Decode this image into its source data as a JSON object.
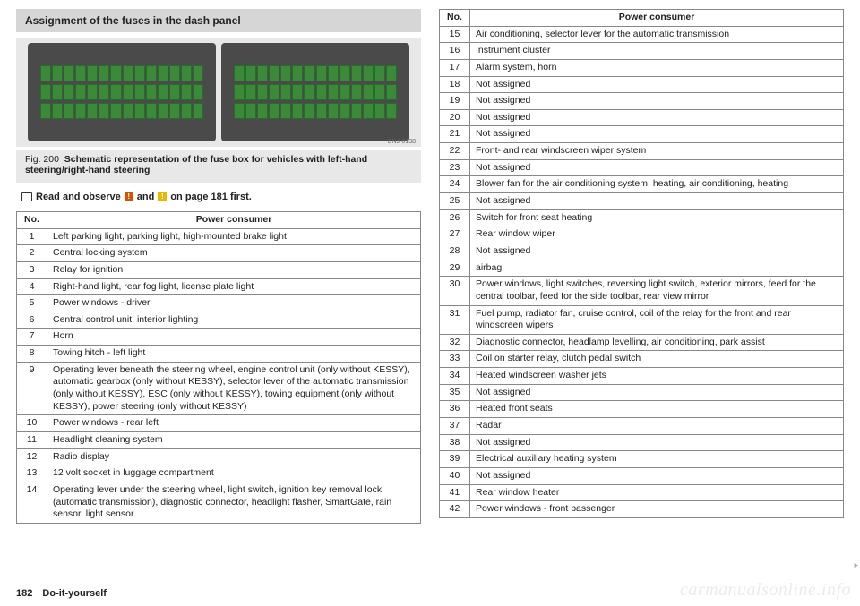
{
  "header": {
    "title": "Assignment of the fuses in the dash panel"
  },
  "figure": {
    "code": "BNJ-0138",
    "label": "Fig. 200",
    "caption": "Schematic representation of the fuse box for vehicles with left-hand steering/right-hand steering"
  },
  "read_observe": {
    "prefix": "Read and observe",
    "mid": "and",
    "suffix": "on page 181 first."
  },
  "table_headers": {
    "no": "No.",
    "consumer": "Power consumer"
  },
  "fuses_left": [
    {
      "no": "1",
      "desc": "Left parking light, parking light, high-mounted brake light"
    },
    {
      "no": "2",
      "desc": "Central locking system"
    },
    {
      "no": "3",
      "desc": "Relay for ignition"
    },
    {
      "no": "4",
      "desc": "Right-hand light, rear fog light, license plate light"
    },
    {
      "no": "5",
      "desc": "Power windows - driver"
    },
    {
      "no": "6",
      "desc": "Central control unit, interior lighting"
    },
    {
      "no": "7",
      "desc": "Horn"
    },
    {
      "no": "8",
      "desc": "Towing hitch - left light"
    },
    {
      "no": "9",
      "desc": "Operating lever beneath the steering wheel, engine control unit (only without KESSY), automatic gearbox (only without KESSY), selector lever of the automatic transmission (only without KESSY), ESC (only without KESSY), towing equipment (only without KESSY), power steering (only without KESSY)"
    },
    {
      "no": "10",
      "desc": "Power windows - rear left"
    },
    {
      "no": "11",
      "desc": "Headlight cleaning system"
    },
    {
      "no": "12",
      "desc": "Radio display"
    },
    {
      "no": "13",
      "desc": "12 volt socket in luggage compartment"
    },
    {
      "no": "14",
      "desc": "Operating lever under the steering wheel, light switch, ignition key removal lock (automatic transmission), diagnostic connector, headlight flasher, SmartGate, rain sensor, light sensor"
    }
  ],
  "fuses_right": [
    {
      "no": "15",
      "desc": "Air conditioning, selector lever for the automatic transmission"
    },
    {
      "no": "16",
      "desc": "Instrument cluster"
    },
    {
      "no": "17",
      "desc": "Alarm system, horn"
    },
    {
      "no": "18",
      "desc": "Not assigned"
    },
    {
      "no": "19",
      "desc": "Not assigned"
    },
    {
      "no": "20",
      "desc": "Not assigned"
    },
    {
      "no": "21",
      "desc": "Not assigned"
    },
    {
      "no": "22",
      "desc": "Front- and rear windscreen wiper system"
    },
    {
      "no": "23",
      "desc": "Not assigned"
    },
    {
      "no": "24",
      "desc": "Blower fan for the air conditioning system, heating, air conditioning, heating"
    },
    {
      "no": "25",
      "desc": "Not assigned"
    },
    {
      "no": "26",
      "desc": "Switch for front seat heating"
    },
    {
      "no": "27",
      "desc": "Rear window wiper"
    },
    {
      "no": "28",
      "desc": "Not assigned"
    },
    {
      "no": "29",
      "desc": "airbag"
    },
    {
      "no": "30",
      "desc": "Power windows, light switches, reversing light switch, exterior mirrors, feed for the central toolbar, feed for the side toolbar, rear view mirror"
    },
    {
      "no": "31",
      "desc": "Fuel pump, radiator fan, cruise control, coil of the relay for the front and rear windscreen wipers"
    },
    {
      "no": "32",
      "desc": "Diagnostic connector, headlamp levelling, air conditioning, park assist"
    },
    {
      "no": "33",
      "desc": "Coil on starter relay, clutch pedal switch"
    },
    {
      "no": "34",
      "desc": "Heated windscreen washer jets"
    },
    {
      "no": "35",
      "desc": "Not assigned"
    },
    {
      "no": "36",
      "desc": "Heated front seats"
    },
    {
      "no": "37",
      "desc": "Radar"
    },
    {
      "no": "38",
      "desc": "Not assigned"
    },
    {
      "no": "39",
      "desc": "Electrical auxiliary heating system"
    },
    {
      "no": "40",
      "desc": "Not assigned"
    },
    {
      "no": "41",
      "desc": "Rear window heater"
    },
    {
      "no": "42",
      "desc": "Power windows - front passenger"
    }
  ],
  "footer": {
    "page": "182",
    "section": "Do-it-yourself"
  },
  "watermark": "carmanualsonline.info"
}
